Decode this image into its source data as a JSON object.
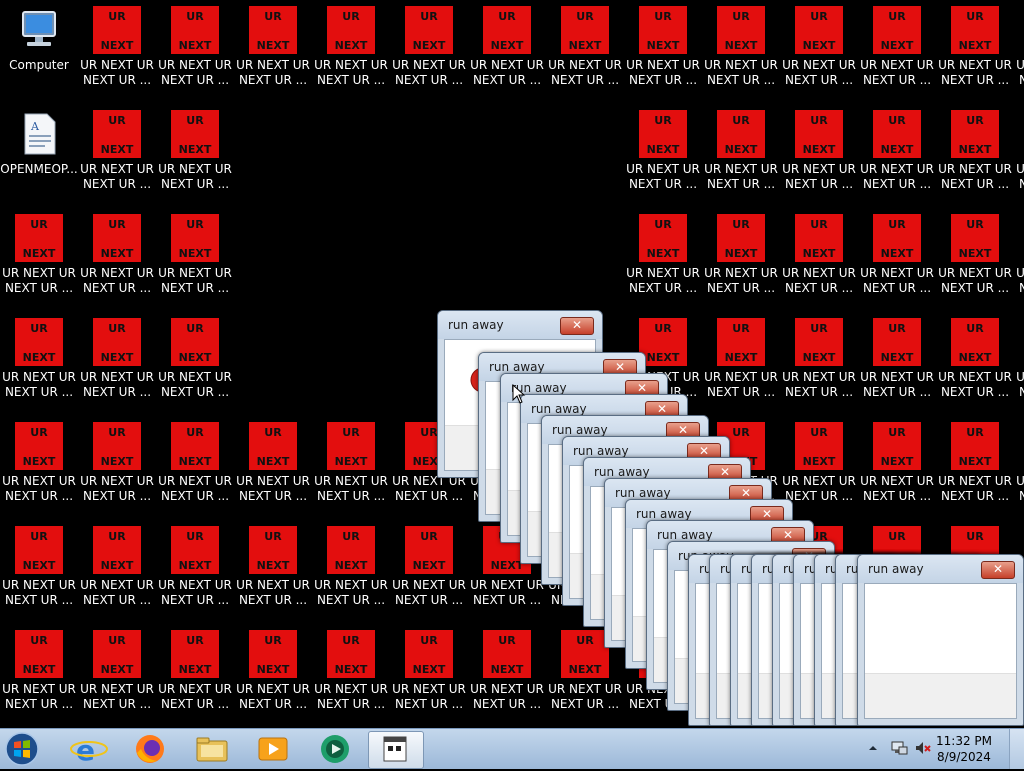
{
  "desktop": {
    "computer_label": "Computer",
    "openmeop_label": "OPENMEOP...",
    "ur_box_top": "UR",
    "ur_box_bottom": "NEXT",
    "ur_label_line1": "UR NEXT UR",
    "ur_label_line2": "NEXT UR ..."
  },
  "dialogs": {
    "title": "run away",
    "close_glyph": "✕"
  },
  "taskbar": {
    "time": "11:32 PM",
    "date": "8/9/2024"
  },
  "colors": {
    "ur_red": "#e30e0e",
    "desktop_bg": "#000000",
    "taskbar_top": "#c4d7ec"
  },
  "icons": [
    "computer-icon",
    "document-icon",
    "start-orb-icon",
    "ie-icon",
    "firefox-icon",
    "explorer-icon",
    "media-player-icon",
    "media-center-icon",
    "app-window-icon",
    "up-arrow-icon",
    "network-icon",
    "speaker-muted-icon"
  ]
}
